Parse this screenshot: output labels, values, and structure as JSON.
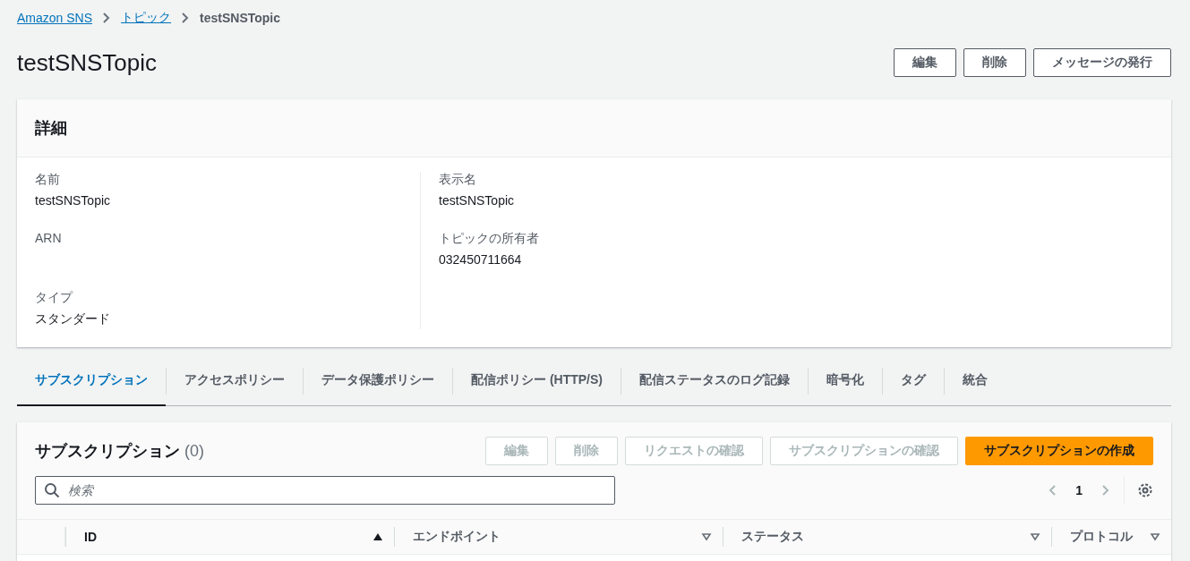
{
  "breadcrumbs": [
    {
      "label": "Amazon SNS",
      "kind": "link"
    },
    {
      "label": "トピック",
      "kind": "link"
    },
    {
      "label": "testSNSTopic",
      "kind": "current"
    }
  ],
  "title": "testSNSTopic",
  "header_buttons": [
    {
      "label": "編集"
    },
    {
      "label": "削除"
    },
    {
      "label": "メッセージの発行"
    }
  ],
  "details": {
    "heading": "詳細",
    "columns": [
      [
        {
          "label": "名前",
          "value": "testSNSTopic"
        },
        {
          "label": "ARN"
        },
        {
          "label": "タイプ",
          "value": "スタンダード"
        }
      ],
      [
        {
          "label": "表示名",
          "value": "testSNSTopic"
        },
        {
          "label": "トピックの所有者",
          "value": "032450711664"
        }
      ]
    ]
  },
  "tabs": [
    {
      "label": "サブスクリプション",
      "selected": true
    },
    {
      "label": "アクセスポリシー",
      "selected": false
    },
    {
      "label": "データ保護ポリシー",
      "selected": false
    },
    {
      "label": "配信ポリシー (HTTP/S)",
      "selected": false
    },
    {
      "label": "配信ステータスのログ記録",
      "selected": false
    },
    {
      "label": "暗号化",
      "selected": false
    },
    {
      "label": "タグ",
      "selected": false
    },
    {
      "label": "統合",
      "selected": false
    }
  ],
  "subscriptions": {
    "heading": "サブスクリプション",
    "count": "(0)",
    "buttons": [
      {
        "label": "編集",
        "kind": "normal",
        "disabled": true
      },
      {
        "label": "削除",
        "kind": "normal",
        "disabled": true
      },
      {
        "label": "リクエストの確認",
        "kind": "normal",
        "disabled": true
      },
      {
        "label": "サブスクリプションの確認",
        "kind": "normal",
        "disabled": true
      },
      {
        "label": "サブスクリプションの作成",
        "kind": "primary",
        "disabled": false
      }
    ],
    "search": {
      "placeholder": "検索"
    },
    "page": "1",
    "columns": [
      {
        "label": "ID",
        "sorted": true
      },
      {
        "label": "エンドポイント",
        "sorted": false
      },
      {
        "label": "ステータス",
        "sorted": false
      },
      {
        "label": "プロトコル",
        "sorted": false
      }
    ]
  }
}
